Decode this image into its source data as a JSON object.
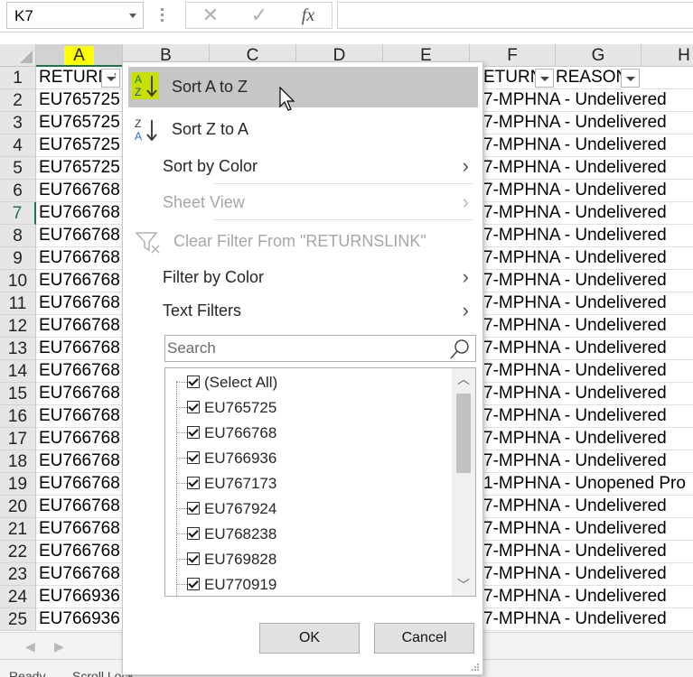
{
  "name_box": {
    "value": "K7"
  },
  "formula_bar": {
    "cancel_icon": "✕",
    "enter_icon": "✓",
    "fx_label": "fx",
    "formula": ""
  },
  "columns": [
    "A",
    "B",
    "C",
    "D",
    "E",
    "F",
    "G",
    "H"
  ],
  "rows": [
    {
      "num": "1",
      "a": "RETURN",
      "f": "ETURN",
      "g": "REASON"
    },
    {
      "num": "2",
      "a": "EU765725",
      "f": "7-MPHNA - Undelivered"
    },
    {
      "num": "3",
      "a": "EU765725",
      "f": "7-MPHNA - Undelivered"
    },
    {
      "num": "4",
      "a": "EU765725",
      "f": "7-MPHNA - Undelivered"
    },
    {
      "num": "5",
      "a": "EU765725",
      "f": "7-MPHNA - Undelivered"
    },
    {
      "num": "6",
      "a": "EU766768",
      "f": "7-MPHNA - Undelivered"
    },
    {
      "num": "7",
      "a": "EU766768",
      "f": "7-MPHNA - Undelivered"
    },
    {
      "num": "8",
      "a": "EU766768",
      "f": "7-MPHNA - Undelivered"
    },
    {
      "num": "9",
      "a": "EU766768",
      "f": "7-MPHNA - Undelivered"
    },
    {
      "num": "10",
      "a": "EU766768",
      "f": "7-MPHNA - Undelivered"
    },
    {
      "num": "11",
      "a": "EU766768",
      "f": "7-MPHNA - Undelivered"
    },
    {
      "num": "12",
      "a": "EU766768",
      "f": "7-MPHNA - Undelivered"
    },
    {
      "num": "13",
      "a": "EU766768",
      "f": "7-MPHNA - Undelivered"
    },
    {
      "num": "14",
      "a": "EU766768",
      "f": "7-MPHNA - Undelivered"
    },
    {
      "num": "15",
      "a": "EU766768",
      "f": "7-MPHNA - Undelivered"
    },
    {
      "num": "16",
      "a": "EU766768",
      "f": "7-MPHNA - Undelivered"
    },
    {
      "num": "17",
      "a": "EU766768",
      "f": "7-MPHNA - Undelivered"
    },
    {
      "num": "18",
      "a": "EU766768",
      "f": "7-MPHNA - Undelivered"
    },
    {
      "num": "19",
      "a": "EU766768",
      "f": "1-MPHNA - Unopened Pro"
    },
    {
      "num": "20",
      "a": "EU766768",
      "f": "7-MPHNA - Undelivered"
    },
    {
      "num": "21",
      "a": "EU766768",
      "f": "7-MPHNA - Undelivered"
    },
    {
      "num": "22",
      "a": "EU766768",
      "f": "7-MPHNA - Undelivered"
    },
    {
      "num": "23",
      "a": "EU766768",
      "f": "7-MPHNA - Undelivered"
    },
    {
      "num": "24",
      "a": "EU766936",
      "f": "7-MPHNA - Undelivered"
    },
    {
      "num": "25",
      "a": "EU766936",
      "f": "7-MPHNA - Undelivered"
    }
  ],
  "menu": {
    "sort_asc": "Sort A to Z",
    "sort_desc": "Sort Z to A",
    "sort_by_color": "Sort by Color",
    "sheet_view": "Sheet View",
    "clear_filter": "Clear Filter From \"RETURNSLINK\"",
    "filter_by_color": "Filter by Color",
    "text_filters": "Text Filters",
    "search_placeholder": "Search",
    "items": [
      "(Select All)",
      "EU765725",
      "EU766768",
      "EU766936",
      "EU767173",
      "EU767924",
      "EU768238",
      "EU769828",
      "EU770919"
    ],
    "ok": "OK",
    "cancel": "Cancel"
  },
  "status_bar": {
    "ready": "Ready",
    "scroll_lock": "Scroll Lock"
  },
  "colors": {
    "highlight": "#c8e000",
    "excel_green": "#217346",
    "hover": "#c6c6c6"
  }
}
